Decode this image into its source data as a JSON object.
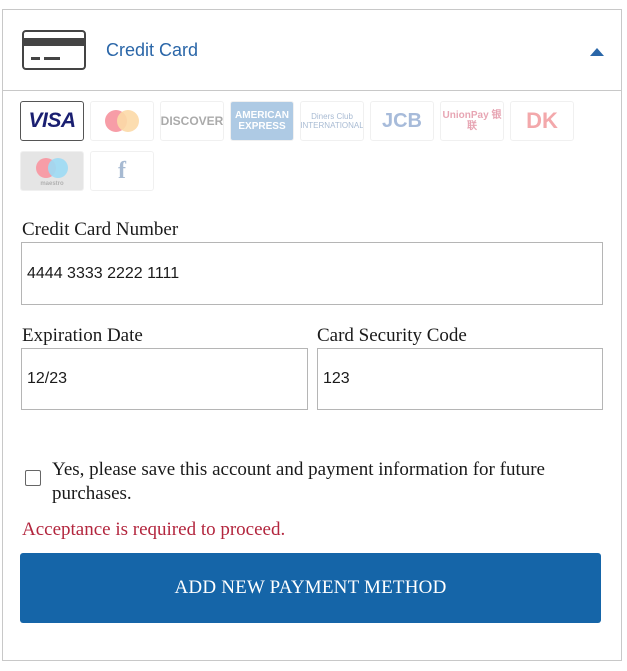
{
  "payment_panel": {
    "title": "Credit Card",
    "header_icon": "credit-card-icon",
    "toggle_icon": "caret-up-icon"
  },
  "card_brands": [
    {
      "name": "visa",
      "label": "VISA",
      "selected": true
    },
    {
      "name": "mastercard",
      "label": "",
      "selected": false
    },
    {
      "name": "discover",
      "label": "DISCOVER",
      "selected": false
    },
    {
      "name": "american-express",
      "label": "AMERICAN EXPRESS",
      "selected": false
    },
    {
      "name": "diners-club",
      "label": "Diners Club INTERNATIONAL",
      "selected": false
    },
    {
      "name": "jcb",
      "label": "JCB",
      "selected": false
    },
    {
      "name": "unionpay",
      "label": "UnionPay 银联",
      "selected": false
    },
    {
      "name": "dankort",
      "label": "DK",
      "selected": false
    },
    {
      "name": "maestro",
      "label": "maestro",
      "selected": false
    },
    {
      "name": "forbrugsforeningen",
      "label": "f",
      "selected": false
    }
  ],
  "form": {
    "card_number_label": "Credit Card Number",
    "card_number_value": "4444 3333 2222 1111",
    "expiration_label": "Expiration Date",
    "expiration_value": "12/23",
    "security_code_label": "Card Security Code",
    "security_code_value": "123",
    "save_consent_text": "Yes, please save this account and payment information for future purchases.",
    "save_consent_checked": false,
    "error_text": "Acceptance is required to proceed.",
    "submit_label": "ADD NEW PAYMENT METHOD"
  },
  "colors": {
    "accent": "#2a66a8",
    "button": "#1565a8",
    "error": "#b3263e",
    "border": "#c8c8c8"
  }
}
